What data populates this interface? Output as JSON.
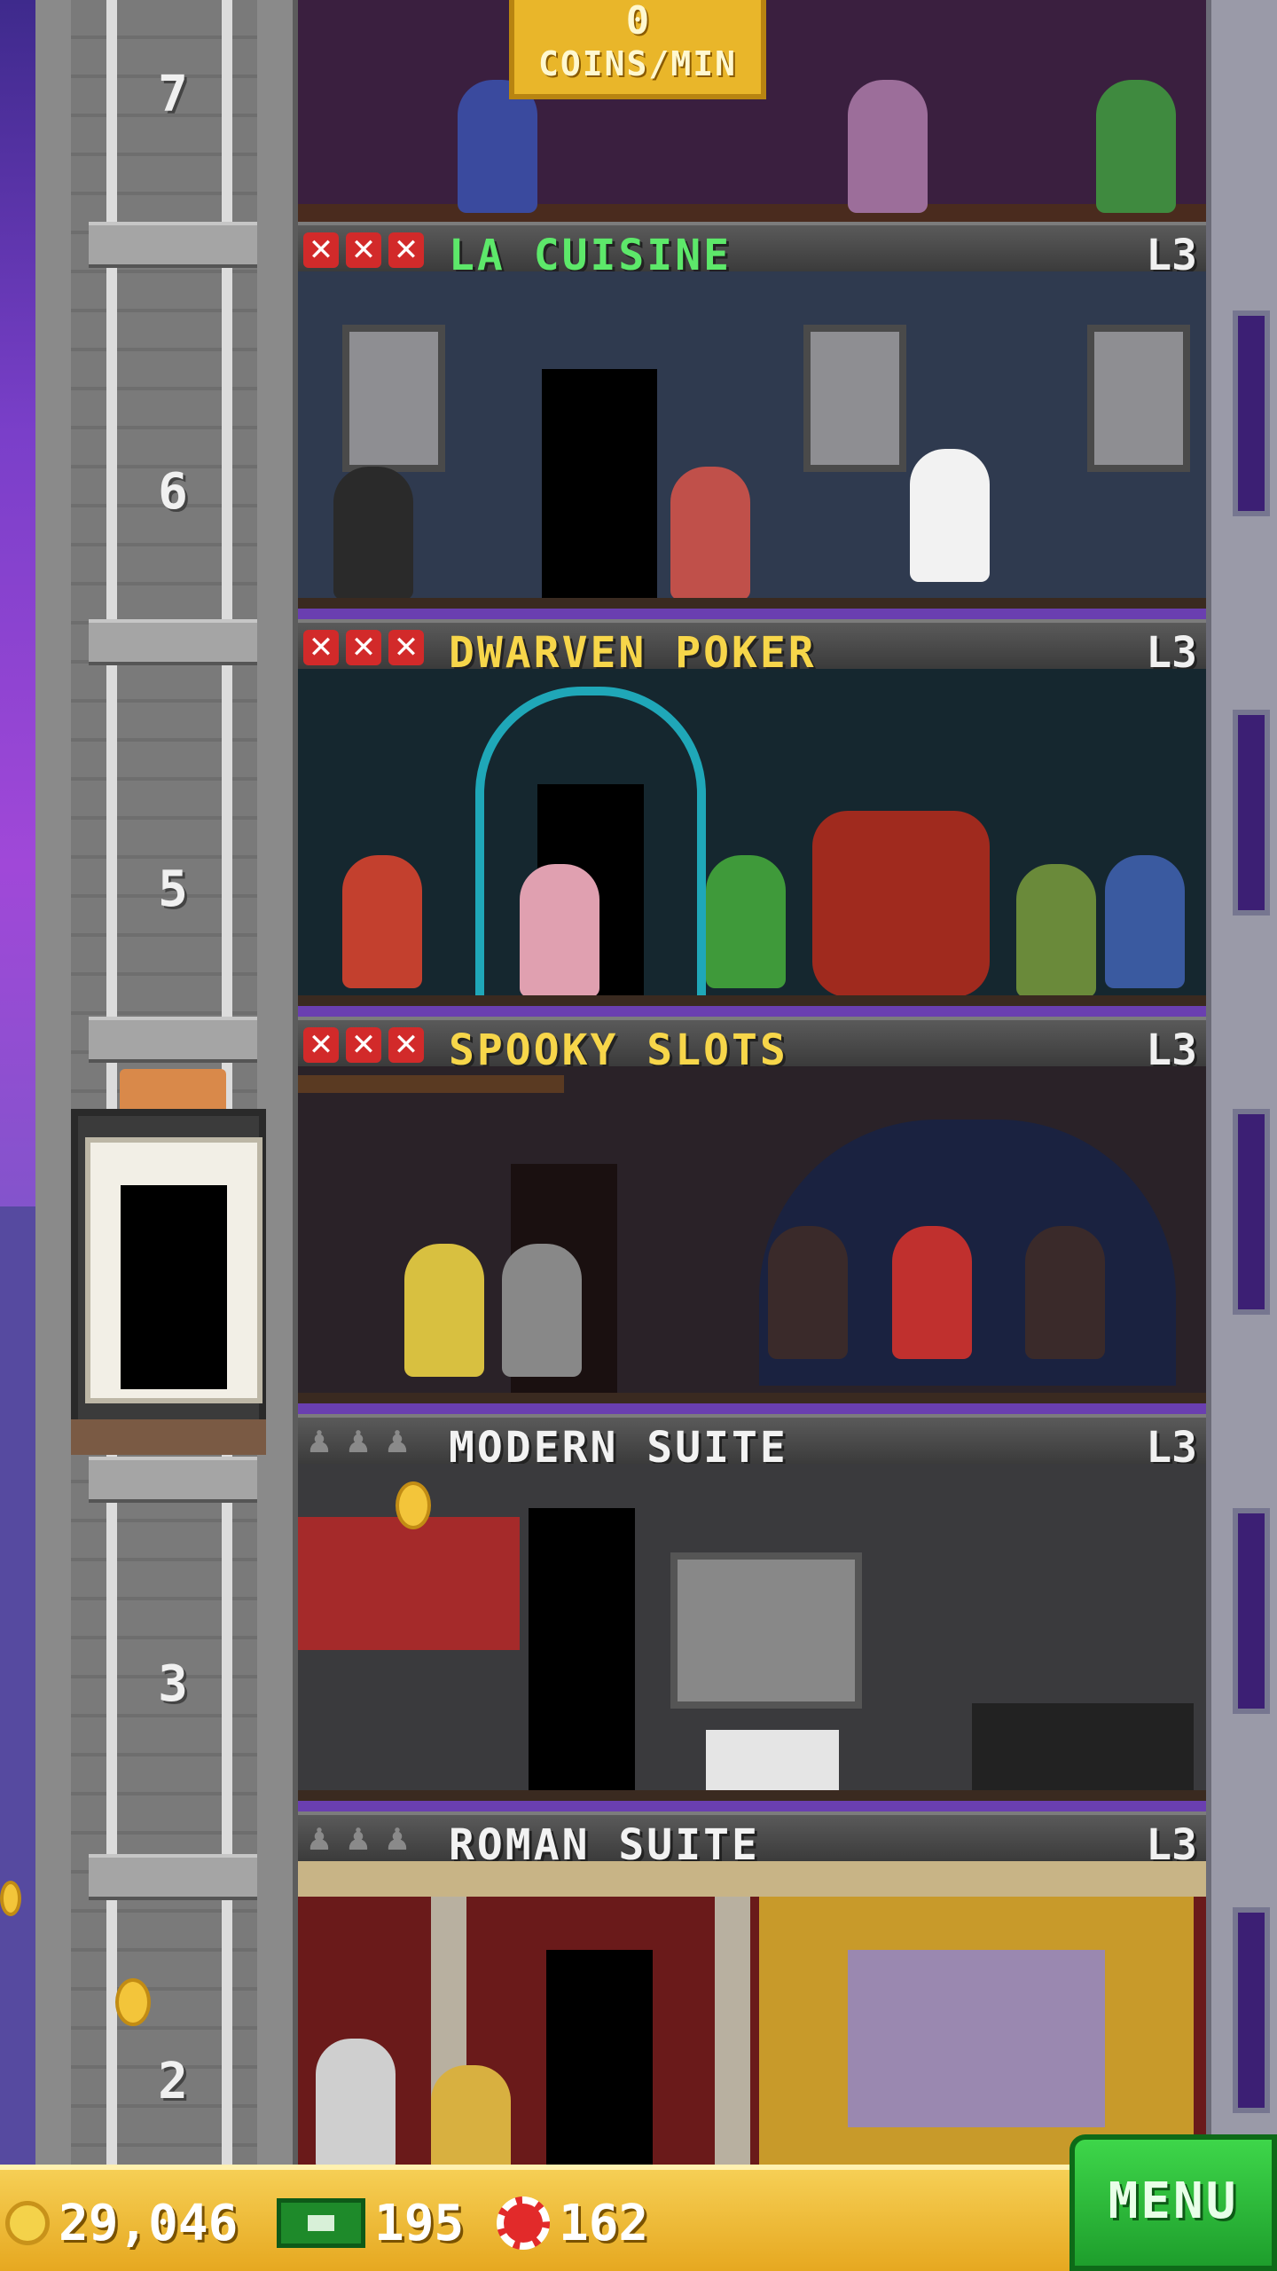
{
  "top_floor": {
    "coins_value": "0",
    "coins_unit": "COINS/MIN"
  },
  "shaft": {
    "floor_numbers": [
      "7",
      "6",
      "5",
      "3",
      "2"
    ]
  },
  "floors": [
    {
      "name": "LA CUISINE",
      "level": "L3",
      "name_color": "#5de86a",
      "stocked": false
    },
    {
      "name": "DWARVEN POKER",
      "level": "L3",
      "name_color": "#f7d64a",
      "stocked": false
    },
    {
      "name": "SPOOKY SLOTS",
      "level": "L3",
      "name_color": "#f7d64a",
      "stocked": false
    },
    {
      "name": "MODERN SUITE",
      "level": "L3",
      "name_color": "#f2f2f2",
      "stocked": true
    },
    {
      "name": "ROMAN SUITE",
      "level": "L3",
      "name_color": "#f2f2f2",
      "stocked": true
    }
  ],
  "status_bar": {
    "coins": "29,046",
    "bux": "195",
    "chips": "162",
    "menu_label": "MENU"
  },
  "icons": {
    "coin": "coin-icon",
    "bux": "bux-icon",
    "chip": "chip-icon",
    "stock_empty": "red-x-icon",
    "resident": "person-icon"
  }
}
